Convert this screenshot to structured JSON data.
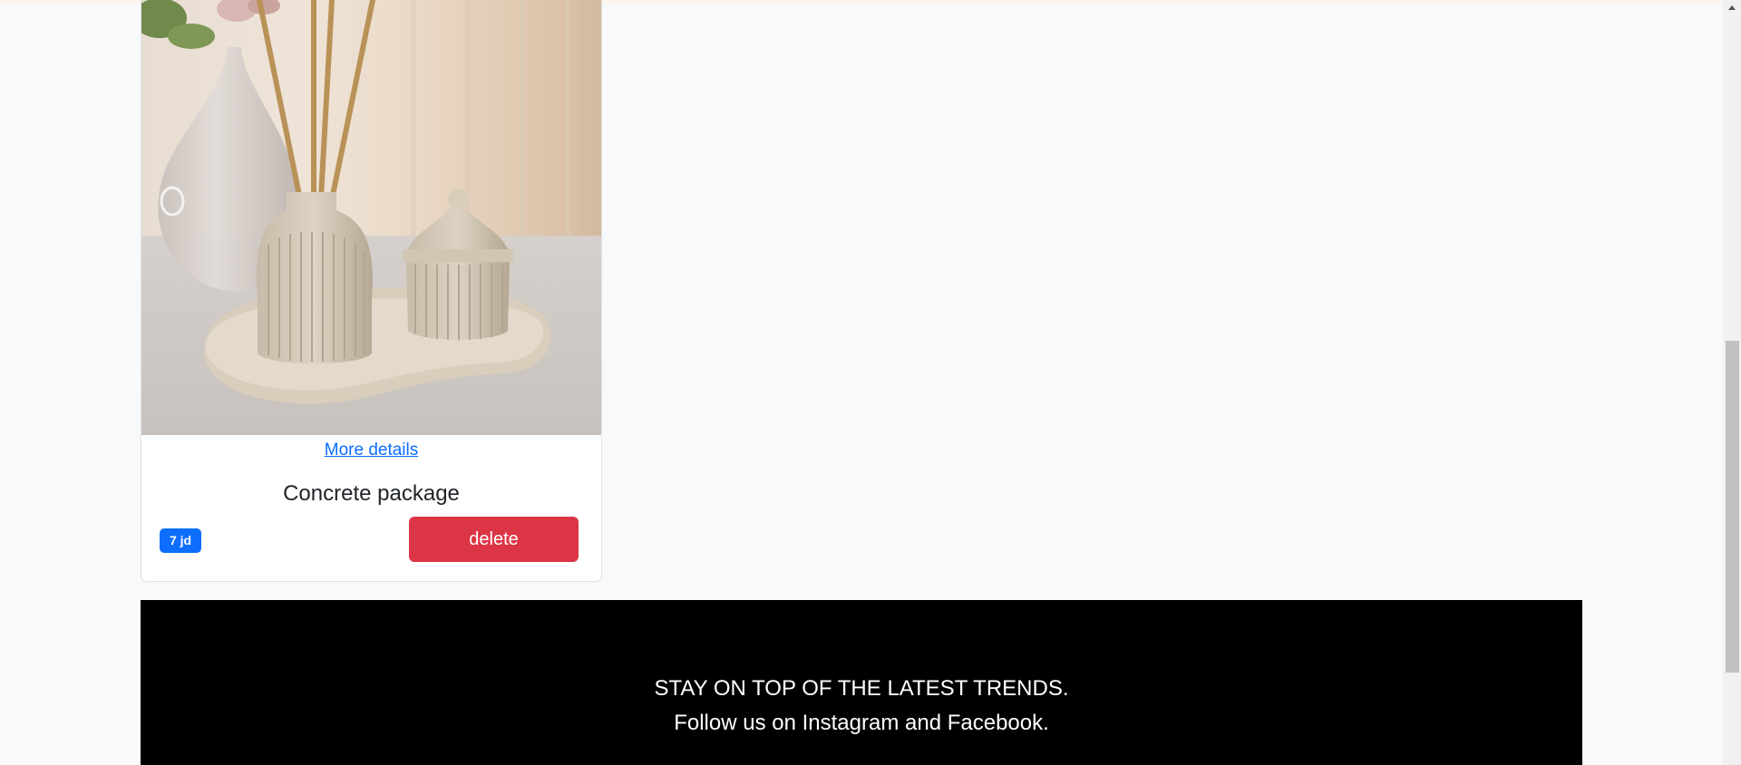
{
  "product": {
    "image_alt": "Ribbed concrete vase with reed sticks, lidded jar on a wavy tray",
    "more_details_label": "More details",
    "title": "Concrete package",
    "price": "7 jd",
    "delete_label": "delete"
  },
  "footer": {
    "line1": "STAY ON TOP OF THE LATEST TRENDS.",
    "line2": "Follow us on Instagram and Facebook."
  },
  "colors": {
    "page_bg": "#f8f9fa",
    "link": "#0d6efd",
    "badge": "#0d6efd",
    "delete_button": "#dc3545",
    "footer_bg": "#000000"
  }
}
